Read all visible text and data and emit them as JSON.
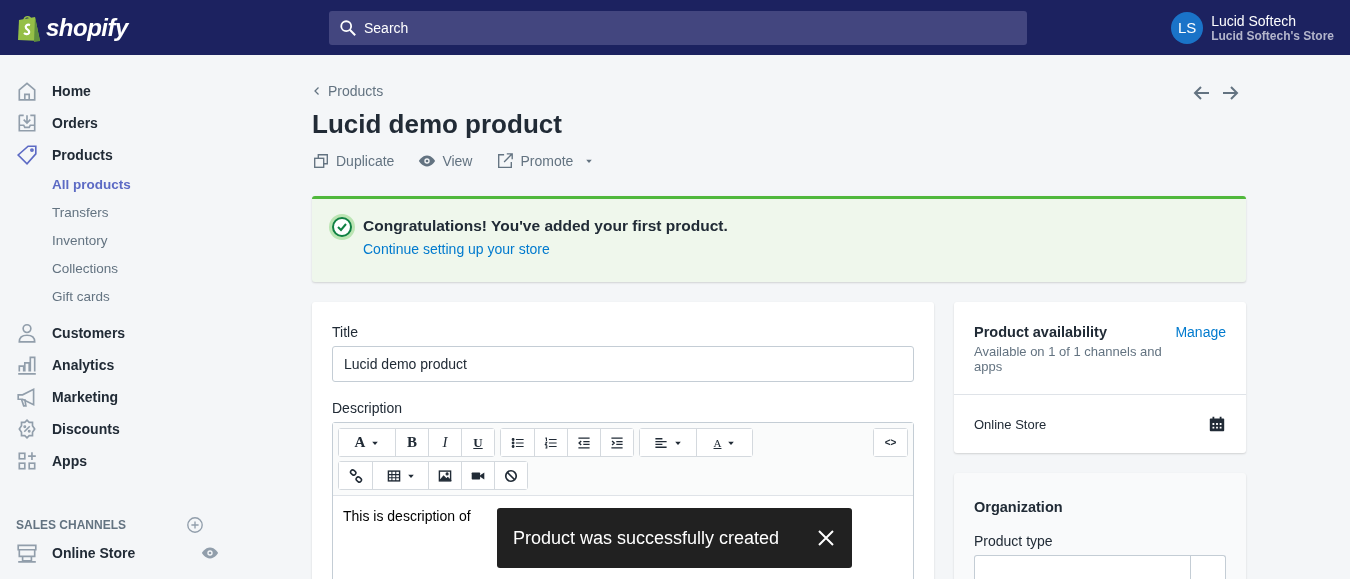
{
  "topbar": {
    "brand": "shopify",
    "search": {
      "placeholder": "Search"
    },
    "user": {
      "initials": "LS",
      "name": "Lucid Softech",
      "store": "Lucid Softech's Store"
    }
  },
  "sidebar": {
    "items": [
      {
        "label": "Home",
        "selected": false
      },
      {
        "label": "Orders",
        "selected": false
      },
      {
        "label": "Products",
        "selected": true,
        "children": [
          {
            "label": "All products",
            "selected": true
          },
          {
            "label": "Transfers",
            "selected": false
          },
          {
            "label": "Inventory",
            "selected": false
          },
          {
            "label": "Collections",
            "selected": false
          },
          {
            "label": "Gift cards",
            "selected": false
          }
        ]
      },
      {
        "label": "Customers",
        "selected": false
      },
      {
        "label": "Analytics",
        "selected": false
      },
      {
        "label": "Marketing",
        "selected": false
      },
      {
        "label": "Discounts",
        "selected": false
      },
      {
        "label": "Apps",
        "selected": false
      }
    ],
    "section_title": "SALES CHANNELS",
    "channels": [
      {
        "label": "Online Store"
      }
    ]
  },
  "page": {
    "breadcrumb": "Products",
    "title": "Lucid demo product",
    "actions": [
      {
        "label": "Duplicate",
        "caret": false
      },
      {
        "label": "View",
        "caret": false
      },
      {
        "label": "Promote",
        "caret": true
      }
    ]
  },
  "banner": {
    "title": "Congratulations! You've added your first product.",
    "link": "Continue setting up your store"
  },
  "product_card": {
    "title_label": "Title",
    "title_value": "Lucid demo product",
    "description_label": "Description",
    "toolbar": [
      [
        [
          {
            "kind": "font",
            "label": "A"
          },
          {
            "kind": "bold",
            "label": "B"
          },
          {
            "kind": "italic",
            "label": "I"
          },
          {
            "kind": "underline",
            "label": "U"
          }
        ],
        [
          {
            "kind": "bullets"
          },
          {
            "kind": "numbers"
          },
          {
            "kind": "outdent"
          },
          {
            "kind": "indent"
          }
        ],
        [
          {
            "kind": "align"
          },
          {
            "kind": "color",
            "label": "A"
          }
        ],
        [
          {
            "kind": "code",
            "label": "<>"
          }
        ]
      ],
      [
        [
          {
            "kind": "link"
          },
          {
            "kind": "table"
          },
          {
            "kind": "image"
          },
          {
            "kind": "video"
          },
          {
            "kind": "clear"
          }
        ]
      ]
    ],
    "description_value": "This is description of"
  },
  "availability": {
    "title": "Product availability",
    "link": "Manage",
    "subtitle": "Available on 1 of 1 channels and apps",
    "channels": [
      {
        "label": "Online Store"
      }
    ]
  },
  "organization": {
    "title": "Organization",
    "product_type_label": "Product type"
  },
  "toast": {
    "message": "Product was successfully created"
  }
}
